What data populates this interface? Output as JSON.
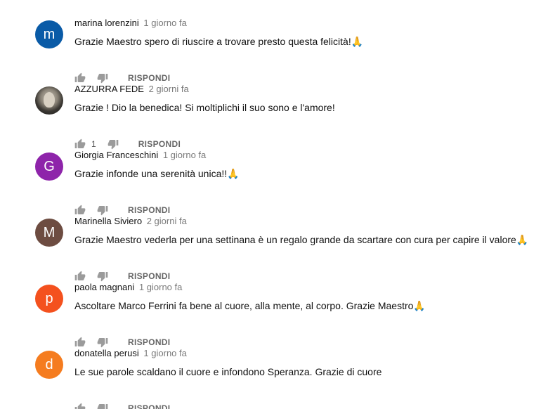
{
  "comments": [
    {
      "author": "marina lorenzini",
      "time": "1 giorno fa",
      "text": "Grazie Maestro spero di riuscire a trovare presto questa felicità!🙏",
      "avatar": {
        "type": "letter",
        "letter": "m",
        "color": "#0a5ba7"
      },
      "likes": "",
      "reply_label": "RISPONDI"
    },
    {
      "author": "AZZURRA FEDE",
      "time": "2 giorni fa",
      "text": "Grazie ! Dio la benedica! Si moltiplichi il suo sono e l'amore!",
      "avatar": {
        "type": "photo",
        "letter": "",
        "color": "#3a3732"
      },
      "likes": "1",
      "reply_label": "RISPONDI"
    },
    {
      "author": "Giorgia Franceschini",
      "time": "1 giorno fa",
      "text": "Grazie infonde una serenità unica!!🙏",
      "avatar": {
        "type": "letter",
        "letter": "G",
        "color": "#8e24aa"
      },
      "likes": "",
      "reply_label": "RISPONDI"
    },
    {
      "author": "Marinella Siviero",
      "time": "2 giorni fa",
      "text": "Grazie Maestro vederla per una settinana è un regalo grande da scartare con cura per capire il valore🙏",
      "avatar": {
        "type": "letter",
        "letter": "M",
        "color": "#6d4c41"
      },
      "likes": "",
      "reply_label": "RISPONDI"
    },
    {
      "author": "paola magnani",
      "time": "1 giorno fa",
      "text": "Ascoltare Marco Ferrini fa bene al cuore, alla mente, al corpo.  Grazie Maestro🙏",
      "avatar": {
        "type": "letter",
        "letter": "p",
        "color": "#f4511e"
      },
      "likes": "",
      "reply_label": "RISPONDI"
    },
    {
      "author": "donatella perusi",
      "time": "1 giorno fa",
      "text": "Le sue parole scaldano il cuore e infondono Speranza. Grazie di cuore",
      "avatar": {
        "type": "letter",
        "letter": "d",
        "color": "#f57c1f"
      },
      "likes": "",
      "reply_label": "RISPONDI"
    }
  ],
  "icons": {
    "like": "thumbs-up-icon",
    "dislike": "thumbs-down-icon"
  }
}
